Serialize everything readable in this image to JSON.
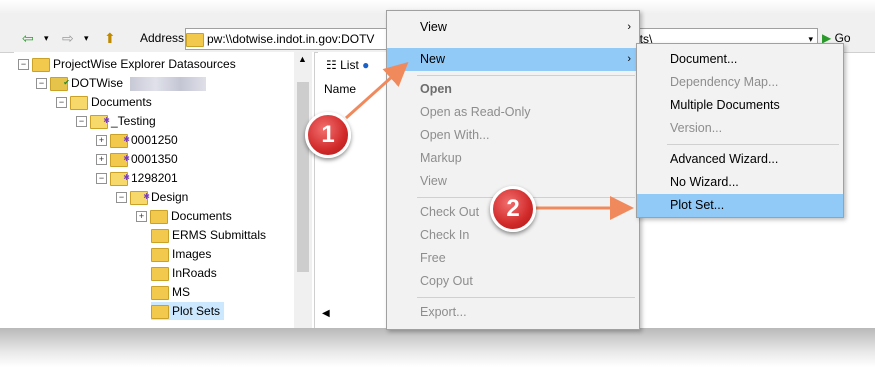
{
  "toolbar": {
    "address_label": "Address",
    "address_value": "pw:\\\\dotwise.indot.in.gov:DOTV",
    "address_tail": "ets\\",
    "go_label": "Go",
    "list_tab_label": "List",
    "name_column": "Name"
  },
  "tree": {
    "items": [
      {
        "label": "ProjectWise Explorer Datasources",
        "expander": "−"
      },
      {
        "label": "DOTWise",
        "expander": "−"
      },
      {
        "label": "Documents",
        "expander": "−"
      },
      {
        "label": "_Testing",
        "expander": "−"
      },
      {
        "label": "0001250",
        "expander": "+"
      },
      {
        "label": "0001350",
        "expander": "+"
      },
      {
        "label": "1298201",
        "expander": "−"
      },
      {
        "label": "Design",
        "expander": "−"
      },
      {
        "label": "Documents",
        "expander": "+"
      },
      {
        "label": "ERMS Submittals",
        "expander": ""
      },
      {
        "label": "Images",
        "expander": ""
      },
      {
        "label": "InRoads",
        "expander": ""
      },
      {
        "label": "MS",
        "expander": ""
      },
      {
        "label": "Plot Sets",
        "expander": ""
      }
    ]
  },
  "context_menu": {
    "items": [
      {
        "label": "View",
        "submenu": true
      },
      {
        "label": "New",
        "submenu": true
      },
      {
        "label": "Open"
      },
      {
        "label": "Open as Read-Only"
      },
      {
        "label": "Open With..."
      },
      {
        "label": "Markup"
      },
      {
        "label": "View"
      },
      {
        "label": "Check Out"
      },
      {
        "label": "Check In"
      },
      {
        "label": "Free"
      },
      {
        "label": "Copy Out"
      },
      {
        "label": "Export..."
      }
    ]
  },
  "submenu": {
    "items": [
      {
        "label": "Document..."
      },
      {
        "label": "Dependency Map..."
      },
      {
        "label": "Multiple Documents"
      },
      {
        "label": "Version..."
      },
      {
        "label": "Advanced Wizard..."
      },
      {
        "label": "No Wizard..."
      },
      {
        "label": "Plot Set..."
      }
    ]
  },
  "callouts": {
    "one": "1",
    "two": "2"
  },
  "colors": {
    "highlight": "#91c9f7",
    "callout_red": "#d12a2a",
    "arrow": "#f08a5d"
  }
}
